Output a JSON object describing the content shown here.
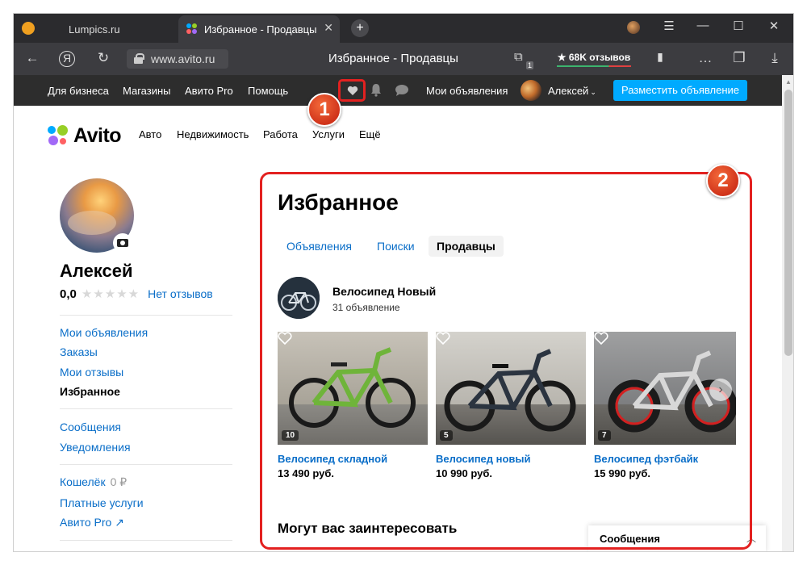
{
  "browser": {
    "tabs": [
      {
        "title": "Lumpics.ru"
      },
      {
        "title": "Избранное - Продавцы"
      }
    ],
    "new_tab_symbol": "+",
    "url": "www.avito.ru",
    "page_title": "Избранное - Продавцы",
    "ext_badge_count": "1",
    "reviews_pill": "★ 68K отзывов",
    "window_buttons": [
      "☰",
      "—",
      "☐",
      "✕"
    ]
  },
  "avito_top": {
    "links": [
      "Для бизнеса",
      "Магазины",
      "Авито Pro",
      "Помощь"
    ],
    "my_ads": "Мои объявления",
    "user": "Алексей",
    "post_button": "Разместить объявление"
  },
  "header": {
    "logo": "Avito",
    "nav": [
      "Авто",
      "Недвижимость",
      "Работа",
      "Услуги",
      "Ещё"
    ]
  },
  "sidebar": {
    "name": "Алексей",
    "rating": "0,0",
    "reviews_link": "Нет отзывов",
    "group1": [
      "Мои объявления",
      "Заказы",
      "Мои отзывы",
      "Избранное"
    ],
    "group2": [
      "Сообщения",
      "Уведомления"
    ],
    "wallet_label": "Кошелёк",
    "wallet_amount": "0 ₽",
    "paid_services": "Платные услуги",
    "avito_pro": "Авито Pro ↗"
  },
  "main": {
    "title": "Избранное",
    "tabs": [
      "Объявления",
      "Поиски",
      "Продавцы"
    ],
    "active_tab": "Продавцы",
    "seller": {
      "name": "Велосипед Новый",
      "count": "31 объявление"
    },
    "cards": [
      {
        "title": "Велосипед складной",
        "price": "13 490 руб.",
        "photos": "10",
        "frame_color": "#6fb43a"
      },
      {
        "title": "Велосипед новый",
        "price": "10 990 руб.",
        "photos": "5",
        "frame_color": "#2b3440"
      },
      {
        "title": "Велосипед фэтбайк",
        "price": "15 990 руб.",
        "photos": "7",
        "frame_color": "#d8d8d8"
      }
    ],
    "section_title": "Могут вас заинтересовать",
    "messages_panel": "Сообщения"
  },
  "annotations": {
    "marker1": "1",
    "marker2": "2",
    "color": "#e32120"
  }
}
